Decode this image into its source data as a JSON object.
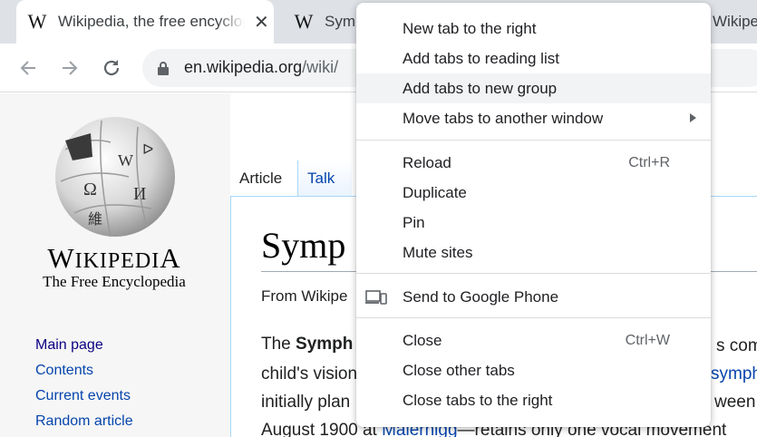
{
  "browser": {
    "tabs": [
      {
        "favicon": "W",
        "title": "Wikipedia, the free encyclopedia",
        "close": "✕"
      },
      {
        "favicon": "W",
        "title": "Symp"
      },
      {
        "title": "Wikipe"
      }
    ],
    "url_host": "en.wikipedia.org",
    "url_path": "/wiki/"
  },
  "wiki": {
    "wordmark_big": "W",
    "wordmark_rest_1": "IKIPEDI",
    "wordmark_big_2": "A",
    "tagline": "The Free Encyclopedia",
    "nav_links": [
      "Main page",
      "Contents",
      "Current events",
      "Random article"
    ],
    "page_tabs": [
      "Article",
      "Talk"
    ],
    "heading": "Symp",
    "from": "From Wikipe",
    "para": {
      "l1_pre": "The ",
      "l1_bold": "Symph",
      "l2": "child's vision",
      "l3": "initially plan",
      "l4_pre": "August 1900 at ",
      "l4_link": "Maiernigg",
      "l4_post": "—retains only one vocal movement",
      "r1": "s comp",
      "r2": "symph",
      "r3": "ween t"
    }
  },
  "context_menu": {
    "items": [
      {
        "label": "New tab to the right"
      },
      {
        "label": "Add tabs to reading list"
      },
      {
        "label": "Add tabs to new group",
        "highlighted": true
      },
      {
        "label": "Move tabs to another window",
        "submenu": true
      },
      {
        "label": "Reload",
        "shortcut": "Ctrl+R"
      },
      {
        "label": "Duplicate"
      },
      {
        "label": "Pin"
      },
      {
        "label": "Mute sites"
      },
      {
        "label": "Send to Google Phone",
        "icon": "devices-icon"
      },
      {
        "label": "Close",
        "shortcut": "Ctrl+W"
      },
      {
        "label": "Close other tabs"
      },
      {
        "label": "Close tabs to the right"
      }
    ]
  },
  "colors": {
    "chrome_bg": "#dee1e6",
    "link": "#0645ad",
    "menu_highlight": "#f1f3f4"
  }
}
